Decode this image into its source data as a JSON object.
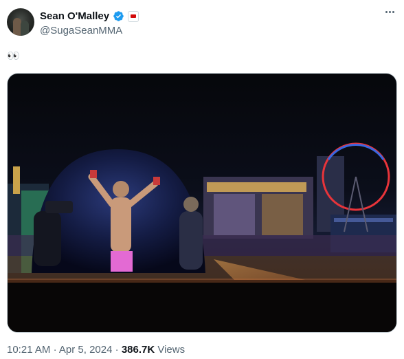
{
  "author": {
    "display_name": "Sean O'Malley",
    "handle": "@SugaSeanMMA",
    "verified": true,
    "verified_color": "#1d9bf0",
    "affiliate_badge_color": "#d20a0a"
  },
  "tweet": {
    "text": "👀",
    "media_description": "Las Vegas skyline at night with Sphere showing a fighter celebrating, High Roller wheel lit red and blue"
  },
  "meta": {
    "time": "10:21 AM",
    "separator": "·",
    "date": "Apr 5, 2024",
    "views_count": "386.7K",
    "views_label": "Views"
  },
  "icons": {
    "more": "more-horizontal-icon",
    "verified": "verified-badge-icon",
    "affiliate": "ufc-affiliate-badge-icon"
  }
}
